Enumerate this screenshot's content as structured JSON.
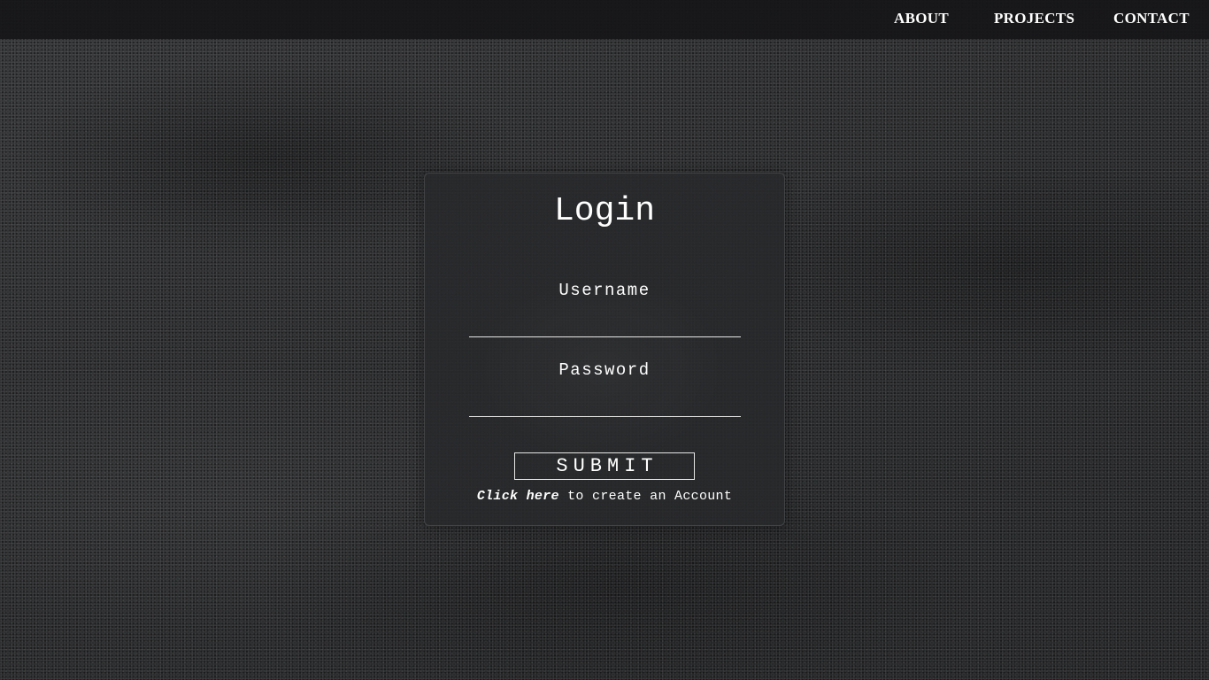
{
  "nav": {
    "about": "ABOUT",
    "projects": "PROJECTS",
    "contact": "CONTACT"
  },
  "login": {
    "title": "Login",
    "username_label": "Username",
    "username_value": "",
    "password_label": "Password",
    "password_value": "",
    "submit_label": "SUBMIT",
    "create_link": "Click here",
    "create_text": " to create an Account"
  },
  "colors": {
    "text": "#ffffff",
    "navbar": "#161618",
    "card": "#28292b",
    "background": "#2a2b2d"
  }
}
